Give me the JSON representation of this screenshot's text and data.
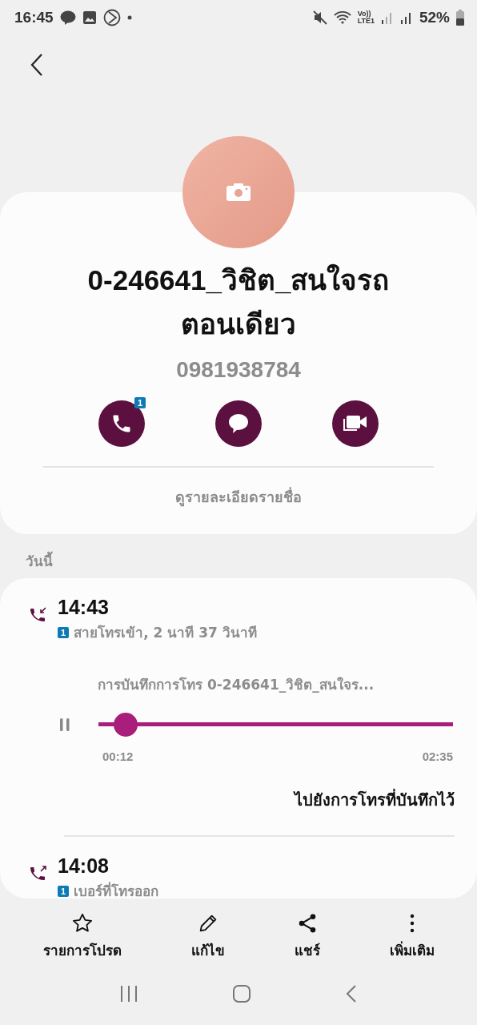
{
  "status_bar": {
    "time": "16:45",
    "network_top": "Vo))",
    "network_bottom": "LTE1",
    "battery": "52%"
  },
  "contact": {
    "name_line1": "0-246641_วิชิต_สนใจรถ",
    "name_line2": "ตอนเดียว",
    "number": "0981938784",
    "call_badge": "1",
    "details_link": "ดูรายละเอียดรายชื่อ"
  },
  "section_label": "วันนี้",
  "calls": [
    {
      "kind": "incoming",
      "time": "14:43",
      "sim": "1",
      "description": "สายโทรเข้า, 2 นาที 37 วินาที",
      "recording": {
        "title": "การบันทึกการโทร 0-246641_วิชิต_สนใจร...",
        "level": 0.077,
        "elapsed": "00:12",
        "total": "02:35",
        "playing": true,
        "link": "ไปยังการโทรที่บันทึกไว้"
      }
    },
    {
      "kind": "outgoing",
      "time": "14:08",
      "sim": "1",
      "description": "เบอร์ที่โทรออก"
    }
  ],
  "bottom_actions": [
    {
      "kind": "favorite",
      "label": "รายการโปรด"
    },
    {
      "kind": "edit",
      "label": "แก้ไข"
    },
    {
      "kind": "share",
      "label": "แชร์"
    },
    {
      "kind": "more",
      "label": "เพิ่มเติม"
    }
  ]
}
